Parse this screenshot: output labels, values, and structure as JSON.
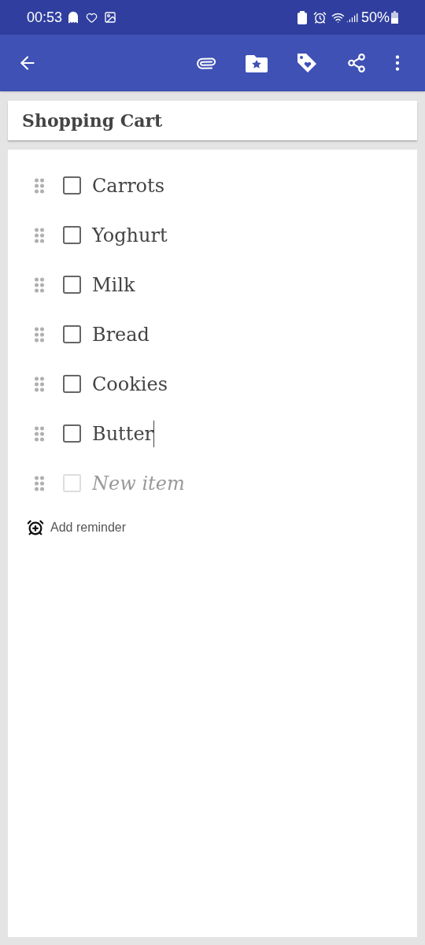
{
  "status_bar": {
    "time": "00:53",
    "battery": "50%"
  },
  "note": {
    "title": "Shopping Cart",
    "items": [
      {
        "text": "Carrots",
        "checked": false,
        "focused": false
      },
      {
        "text": "Yoghurt",
        "checked": false,
        "focused": false
      },
      {
        "text": "Milk",
        "checked": false,
        "focused": false
      },
      {
        "text": "Bread",
        "checked": false,
        "focused": false
      },
      {
        "text": "Cookies",
        "checked": false,
        "focused": false
      },
      {
        "text": "Butter",
        "checked": false,
        "focused": true
      }
    ],
    "new_item": {
      "placeholder": "New item",
      "disabled": true
    },
    "reminder": "Add reminder"
  }
}
